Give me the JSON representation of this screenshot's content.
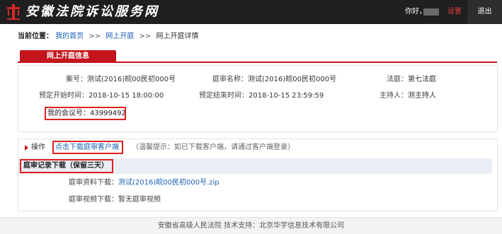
{
  "header": {
    "site_title": "安徽法院诉讼服务网",
    "greeting": "你好，",
    "settings_label": "设置",
    "logout_label": "退出"
  },
  "breadcrumb": {
    "label": "当前位置：",
    "items": [
      "我的首页",
      "网上开庭",
      "网上开庭详情"
    ],
    "separator": ">>"
  },
  "tab": {
    "label": "网上开庭信息"
  },
  "hearing_info": {
    "case_number_label": "案号：",
    "case_number": "测试(2016)皖00民初000号",
    "trial_name_label": "庭审名称：",
    "trial_name": "测试(2016)皖00民初000号",
    "court_label": "法庭：",
    "court": "第七法庭",
    "start_label": "预定开始时间：",
    "start_time": "2018-10-15 18:00:00",
    "end_label": "预定结束时间：",
    "end_time": "2018-10-15 23:59:59",
    "host_label": "主持人：",
    "host": "测主持人",
    "meeting_label": "我的会议号：",
    "meeting_number": "43999492"
  },
  "operations": {
    "label": "操作",
    "download_client_link": "点击下载庭审客户端",
    "tip": "（温馨提示：如已下载客户端，请通过客户端登录）"
  },
  "records": {
    "title": "庭审记录下载（保留三天）",
    "material_label": "庭审资料下载：",
    "material_file": "测试(2016)皖00民初000号.zip",
    "video_label": "庭审视频下载：",
    "video_status": "暂无庭审视频"
  },
  "footer": {
    "text": "安徽省高级人民法院    技术支持：北京华宇信息技术有限公司"
  },
  "colors": {
    "header_bg": "#1f1f1f",
    "accent_red": "#c4141c",
    "highlight_border": "#e02020",
    "link_blue": "#1a5fb4",
    "section_bar": "#e9eef5"
  }
}
